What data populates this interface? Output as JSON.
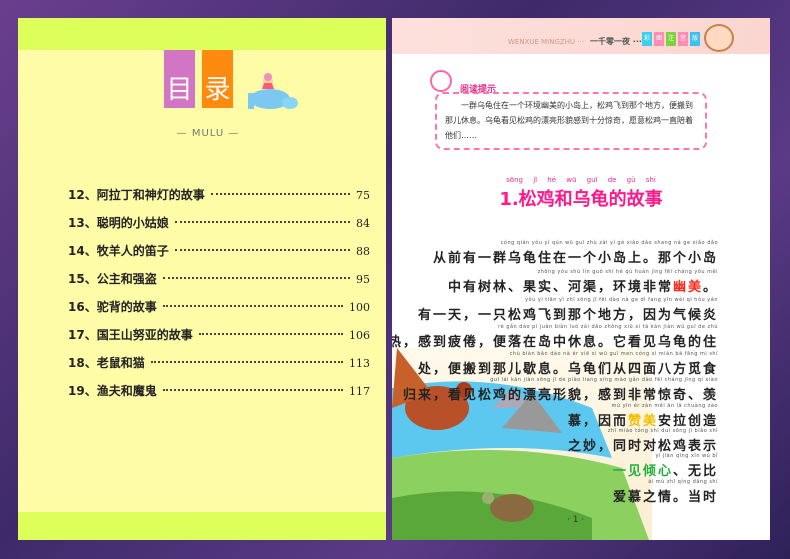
{
  "left_page": {
    "title_chars": [
      "目",
      "录"
    ],
    "subtitle": "MULU",
    "toc": [
      {
        "title": "12、阿拉丁和神灯的故事",
        "page": "75"
      },
      {
        "title": "13、聪明的小姑娘",
        "page": "84"
      },
      {
        "title": "14、牧羊人的笛子",
        "page": "88"
      },
      {
        "title": "15、公主和强盗",
        "page": "95"
      },
      {
        "title": "16、驼背的故事",
        "page": "100"
      },
      {
        "title": "17、国王山努亚的故事",
        "page": "106"
      },
      {
        "title": "18、老鼠和猫",
        "page": "113"
      },
      {
        "title": "19、渔夫和魔鬼",
        "page": "117"
      }
    ]
  },
  "right_page": {
    "header": {
      "series": "WENXUE MINGZHU ···",
      "book": "一千零一夜 ···",
      "tabs": [
        "彩",
        "图",
        "注",
        "音",
        "版"
      ],
      "tab_colors": [
        "#3cd0f0",
        "#ff8cb4",
        "#7cd43c",
        "#ff8cb4",
        "#3cc0f0"
      ]
    },
    "reading_tip": {
      "label": "阅读提示",
      "text": "一群乌龟住在一个环境幽美的小岛上，松鸡飞到那个地方，便搬到那儿休息。乌龟看见松鸡的漂亮形貌感到十分惊奇，愿意松鸡一直陪着他们……"
    },
    "story": {
      "pinyin": "sōng jī hé wū guī de gù shi",
      "title": "1.松鸡和乌龟的故事"
    },
    "lines": [
      {
        "py": "cóng qián yǒu yì qún wū guī zhù zài yí gè xiǎo dǎo shang nà ge xiǎo dǎo",
        "segs": [
          {
            "t": "从前有一群乌龟住在一个小岛上。那个小岛"
          }
        ]
      },
      {
        "py": "zhōng yǒu shù lín guǒ shí hé qú huán jìng fēi cháng yōu měi",
        "segs": [
          {
            "t": "中有树林、果实、河渠，环境非常"
          },
          {
            "t": "幽美",
            "c": "#ff2a1a"
          },
          {
            "t": "。"
          }
        ]
      },
      {
        "py": "yǒu yì tiān yì zhī sōng jī fēi dào nà ge dì fang yīn wèi qì hòu yán",
        "segs": [
          {
            "t": "有一天，一只松鸡飞到那个地方，因为气候炎"
          }
        ]
      },
      {
        "py": "rè gǎn dào pí juàn biàn luò zài dǎo zhōng xiū xi tā kàn jiàn wū guī de zhù",
        "segs": [
          {
            "t": "热，感到疲倦，便落在岛中休息。它看见乌龟的住"
          }
        ]
      },
      {
        "py": "chù biàn bān dào nà ér xiē xi wū guī men cóng sì miàn bā fāng mì shí",
        "segs": [
          {
            "t": "处，便搬到那儿歇息。乌龟们从四面八方觅食"
          }
        ]
      },
      {
        "py": "guī lái kàn jiàn sōng jī de piào liang xíng mào gǎn dào fēi cháng jīng qí xiàn",
        "segs": [
          {
            "t": "归来，看见松鸡的漂亮形貌，感到非常惊奇、羡"
          }
        ]
      },
      {
        "py": "mù yīn ér zàn měi ān lā chuàng zào",
        "segs": [
          {
            "t": "慕，因而"
          },
          {
            "t": "赞美",
            "c": "#f0c000"
          },
          {
            "t": "安拉创造"
          }
        ]
      },
      {
        "py": "zhī miào tóng shí duì sōng jī biǎo shì",
        "segs": [
          {
            "t": "之妙，同时对松鸡表示"
          }
        ]
      },
      {
        "py": "yí jiàn qīng xīn wú bǐ",
        "segs": [
          {
            "t": "一见倾心",
            "c": "#20b040"
          },
          {
            "t": "、无比"
          }
        ]
      },
      {
        "py": "ài mù zhī qíng dāng shí",
        "segs": [
          {
            "t": "爱慕之情。当时"
          }
        ]
      }
    ],
    "page_number": "· 1 ·"
  }
}
